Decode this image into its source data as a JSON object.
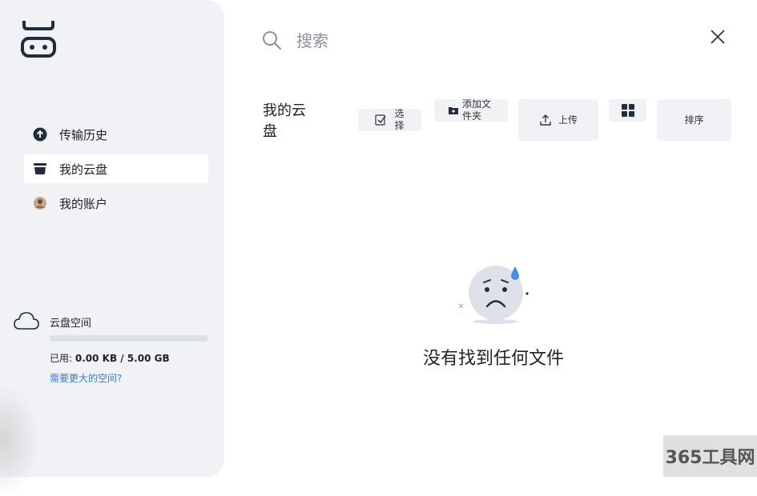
{
  "sidebar": {
    "items": [
      {
        "label": "传输历史",
        "icon": "upload-circle-icon",
        "active": false
      },
      {
        "label": "我的云盘",
        "icon": "drive-stack-icon",
        "active": true
      },
      {
        "label": "我的账户",
        "icon": "avatar-icon",
        "active": false
      }
    ],
    "storage": {
      "title": "云盘空间",
      "usage_prefix": "已用: ",
      "usage_value": "0.00 KB / 5.00 GB",
      "used_fraction": 0.0,
      "more_link": "需要更大的空间?"
    }
  },
  "search": {
    "placeholder": "搜索"
  },
  "main": {
    "title": "我的云盘",
    "toolbar": {
      "select_label": "选择",
      "add_folder_label": "添加文件夹",
      "upload_label": "上传",
      "sort_label": "排序"
    },
    "empty_message": "没有找到任何文件"
  },
  "watermark": "365工具网",
  "colors": {
    "sidebar_bg": "#f0f2f5",
    "button_bg": "#f0f2f5",
    "link": "#3a7bd5",
    "icon_dark": "#1f2d3d",
    "face": "#dde1e8",
    "drop": "#4a8fe7"
  }
}
